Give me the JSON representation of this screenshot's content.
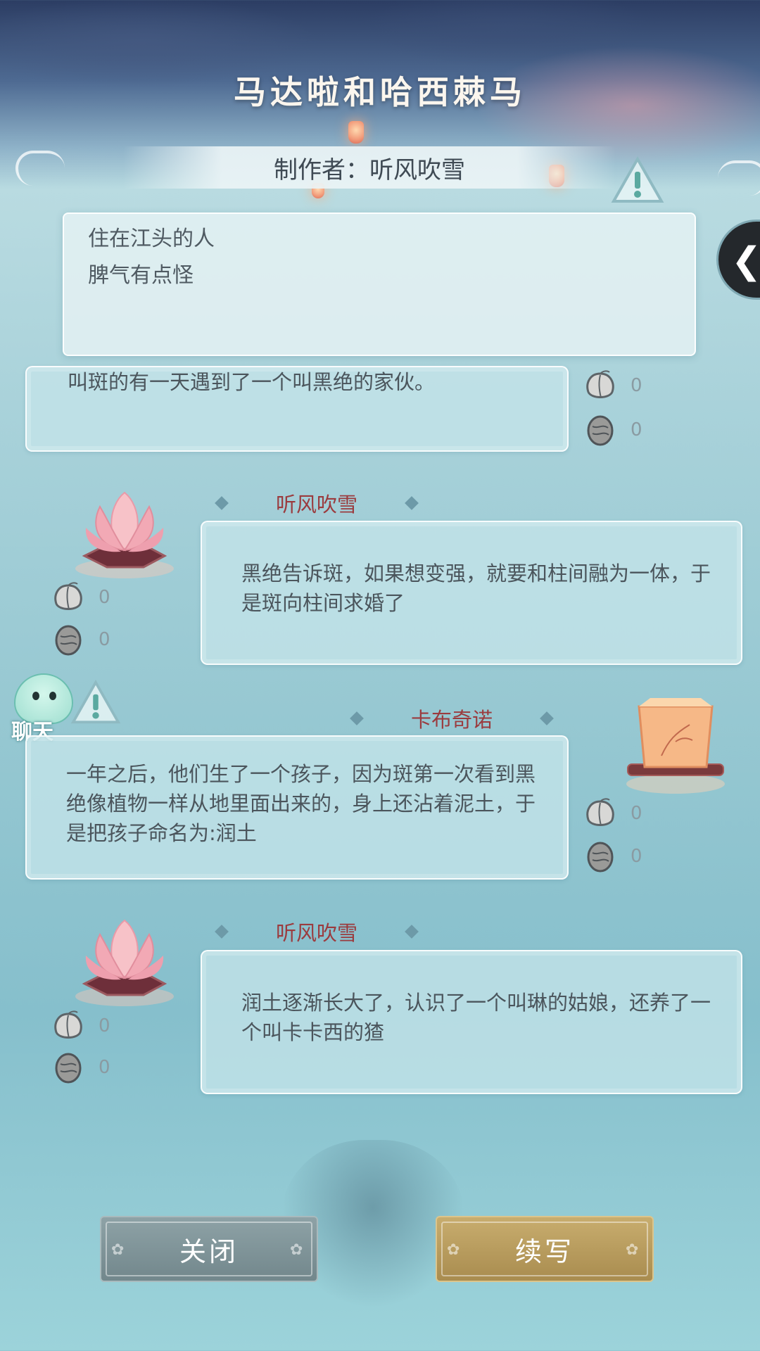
{
  "story": {
    "title": "马达啦和哈西棘马",
    "author_line": "制作者：听风吹雪"
  },
  "summary": {
    "lines": [
      "住在江头的人",
      "脾气有点怪"
    ]
  },
  "entries": [
    {
      "author": "",
      "text": "叫斑的有一天遇到了一个叫黑绝的家伙。",
      "likes": "0",
      "dislikes": "0"
    },
    {
      "author": "听风吹雪",
      "text": "黑绝告诉斑，如果想变强，就要和柱间融为一体，于是斑向柱间求婚了",
      "likes": "0",
      "dislikes": "0"
    },
    {
      "author": "卡布奇诺",
      "text": "一年之后，他们生了一个孩子，因为斑第一次看到黑绝像植物一样从地里面出来的，身上还沾着泥土，于是把孩子命名为:润土",
      "likes": "0",
      "dislikes": "0"
    },
    {
      "author": "听风吹雪",
      "text": "润土逐渐长大了，认识了一个叫琳的姑娘，还养了一个叫卡卡西的猹",
      "likes": "0",
      "dislikes": "0"
    }
  ],
  "chat": {
    "label": "聊天"
  },
  "buttons": {
    "close": "关闭",
    "continue": "续写"
  },
  "icons": {
    "warning": "warning-triangle-icon",
    "back": "chevron-left-icon",
    "like": "peach-icon",
    "dislike": "rotten-peach-icon",
    "avatar_a": "lotus-lantern-icon",
    "avatar_b": "paper-lamp-icon"
  },
  "colors": {
    "author_name": "#9b3b3e",
    "continue_button": "#b89a5c",
    "close_button": "#7f9398"
  }
}
